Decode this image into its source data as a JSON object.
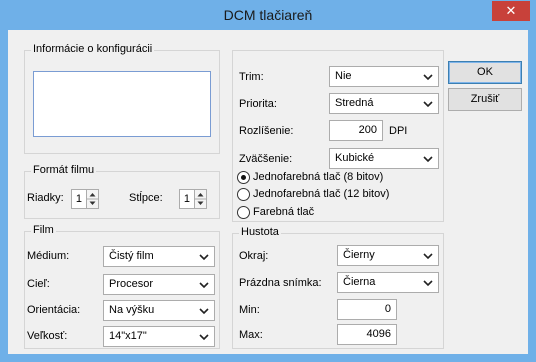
{
  "window": {
    "title": "DCM tlačiareň",
    "close_glyph": "✕",
    "titlebar_color": "#6fb0e8",
    "close_color": "#c8413a"
  },
  "buttons": {
    "ok": "OK",
    "cancel": "Zrušiť"
  },
  "config_info": {
    "title": "Informácie o konfigurácii",
    "text": ""
  },
  "film_format": {
    "title": "Formát filmu",
    "rows_label": "Riadky:",
    "rows_value": "1",
    "cols_label": "Stĺpce:",
    "cols_value": "1"
  },
  "film": {
    "title": "Film",
    "medium_label": "Médium:",
    "medium_value": "Čistý film",
    "target_label": "Cieľ:",
    "target_value": "Procesor",
    "orientation_label": "Orientácia:",
    "orientation_value": "Na výšku",
    "size_label": "Veľkosť:",
    "size_value": "14\"x17\""
  },
  "print_settings": {
    "trim_label": "Trim:",
    "trim_value": "Nie",
    "priority_label": "Priorita:",
    "priority_value": "Stredná",
    "resolution_label": "Rozlíšenie:",
    "resolution_value": "200",
    "resolution_unit": "DPI",
    "zoom_label": "Zväčšenie:",
    "zoom_value": "Kubické",
    "color_modes": [
      {
        "label": "Jednofarebná tlač (8 bitov)",
        "selected": true
      },
      {
        "label": "Jednofarebná tlač (12 bitov)",
        "selected": false
      },
      {
        "label": "Farebná tlač",
        "selected": false
      }
    ]
  },
  "density": {
    "title": "Hustota",
    "border_label": "Okraj:",
    "border_value": "Čierny",
    "empty_frame_label": "Prázdna snímka:",
    "empty_frame_value": "Čierna",
    "min_label": "Min:",
    "min_value": "0",
    "max_label": "Max:",
    "max_value": "4096"
  },
  "icons": {
    "dropdown": "chevron-down-icon",
    "spin": "spin-arrows-icon",
    "close": "close-icon"
  }
}
